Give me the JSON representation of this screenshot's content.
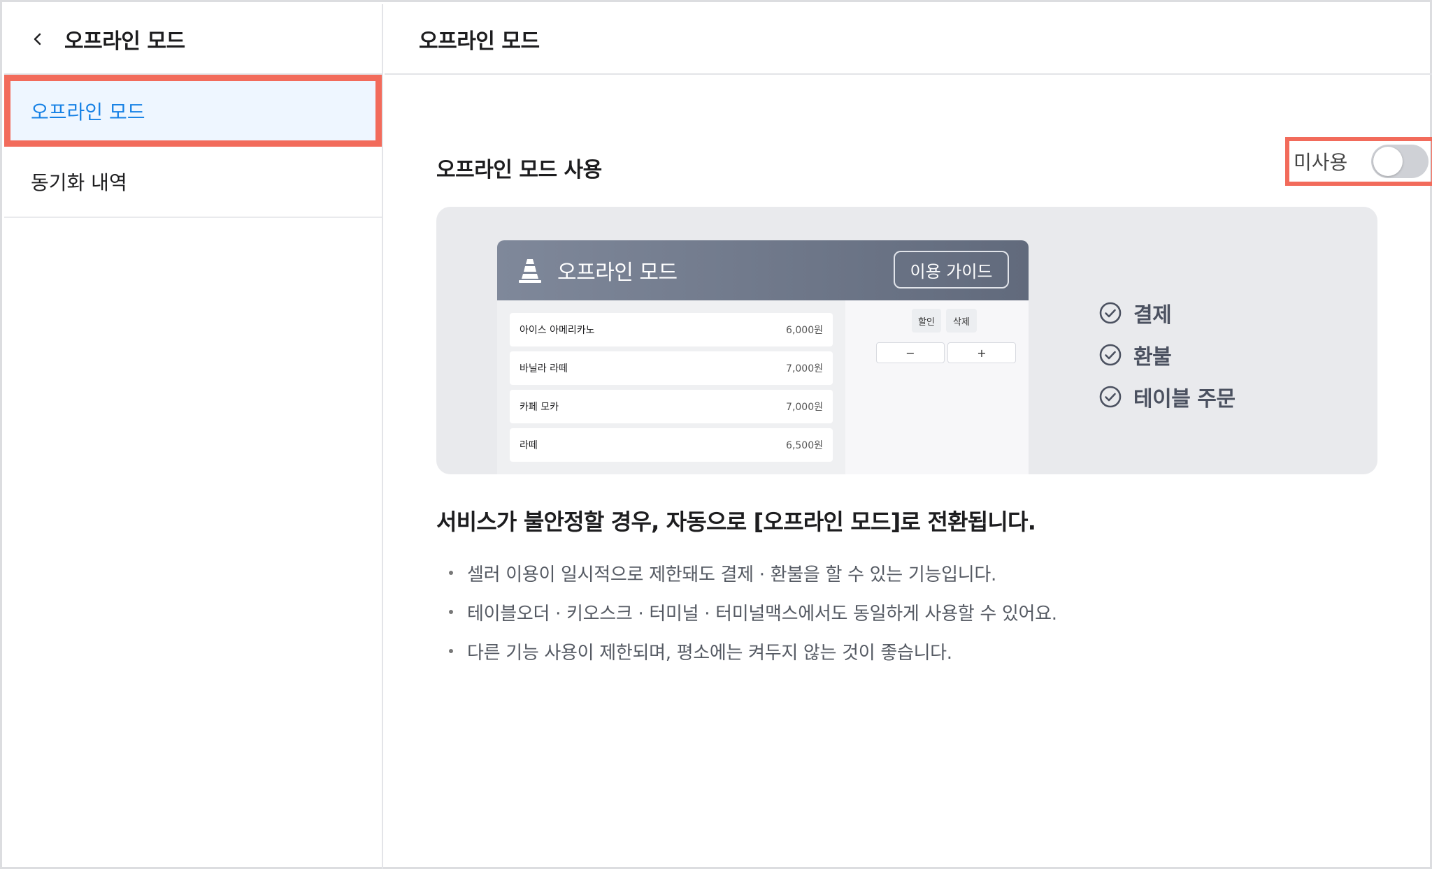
{
  "sidebar": {
    "title": "오프라인 모드",
    "items": [
      {
        "label": "오프라인 모드",
        "active": true
      },
      {
        "label": "동기화 내역",
        "active": false
      }
    ]
  },
  "main": {
    "title": "오프라인 모드",
    "setting": {
      "label": "오프라인 모드 사용",
      "toggle_text": "미사용",
      "toggle_on": false
    },
    "preview": {
      "mock_title": "오프라인 모드",
      "guide_button": "이용 가이드",
      "menu_items": [
        {
          "name": "아이스 아메리카노",
          "price": "6,000원"
        },
        {
          "name": "바닐라 라떼",
          "price": "7,000원"
        },
        {
          "name": "카페 모카",
          "price": "7,000원"
        },
        {
          "name": "라떼",
          "price": "6,500원"
        }
      ],
      "discount_label": "할인",
      "delete_label": "삭제",
      "minus_label": "−",
      "plus_label": "+",
      "features": [
        "결제",
        "환불",
        "테이블 주문"
      ]
    },
    "description": {
      "title": "서비스가 불안정할 경우, 자동으로 [오프라인 모드]로 전환됩니다.",
      "bullets": [
        "셀러 이용이 일시적으로 제한돼도 결제 · 환불을 할 수 있는 기능입니다.",
        "테이블오더 · 키오스크 · 터미널 · 터미널맥스에서도 동일하게 사용할 수 있어요.",
        "다른 기능 사용이 제한되며, 평소에는 켜두지 않는 것이 좋습니다."
      ]
    }
  },
  "colors": {
    "accent": "#1681e5",
    "highlight": "#f26b5b",
    "active_bg": "#eef6ff"
  }
}
